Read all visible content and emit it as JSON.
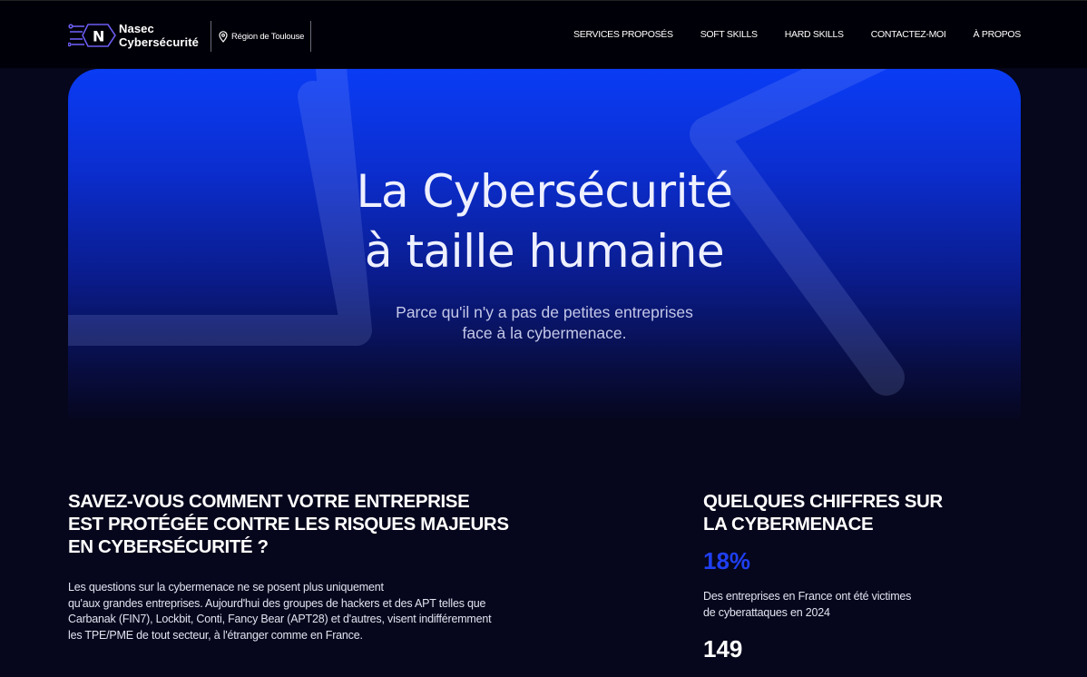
{
  "brand": {
    "line1": "Nasec",
    "line2": "Cybersécurité",
    "logo_letter": "N",
    "region": "Région de Toulouse"
  },
  "nav": {
    "items": [
      {
        "label": "SERVICES PROPOSÉS"
      },
      {
        "label": "SOFT SKILLS"
      },
      {
        "label": "HARD SKILLS"
      },
      {
        "label": "CONTACTEZ-MOI"
      },
      {
        "label": "À PROPOS"
      }
    ]
  },
  "hero": {
    "title_line1": "La Cybersécurité",
    "title_line2": "à taille humaine",
    "subtitle_line1": "Parce qu'il n'y a pas de petites entreprises",
    "subtitle_line2": "face à la cybermenace."
  },
  "protection": {
    "heading_line1": "SAVEZ-VOUS COMMENT VOTRE ENTREPRISE",
    "heading_line2": "EST PROTÉGÉE CONTRE LES RISQUES MAJEURS",
    "heading_line3": "EN CYBERSÉCURITÉ ?",
    "body_line1": "Les questions sur la cybermenace ne se posent plus uniquement",
    "body_line2": "qu'aux grandes entreprises. Aujourd'hui des groupes de hackers et des APT telles que",
    "body_line3": "Carbanak (FIN7), Lockbit, Conti, Fancy Bear (APT28) et d'autres, visent indifféremment",
    "body_line4": "les TPE/PME de tout secteur, à l'étranger comme en France."
  },
  "stats": {
    "heading_line1": "QUELQUES CHIFFRES SUR",
    "heading_line2": "LA CYBERMENACE",
    "stat1_value": "18%",
    "stat1_desc_line1": "Des entreprises en France ont été victimes",
    "stat1_desc_line2": "de cyberattaques en 2024",
    "stat2_value": "149"
  },
  "colors": {
    "background": "#06061c",
    "navbar": "#000008",
    "accent_blue": "#1f3ff0",
    "hero_blue": "#0a3cf5",
    "logo_purple": "#6a5cf0"
  }
}
